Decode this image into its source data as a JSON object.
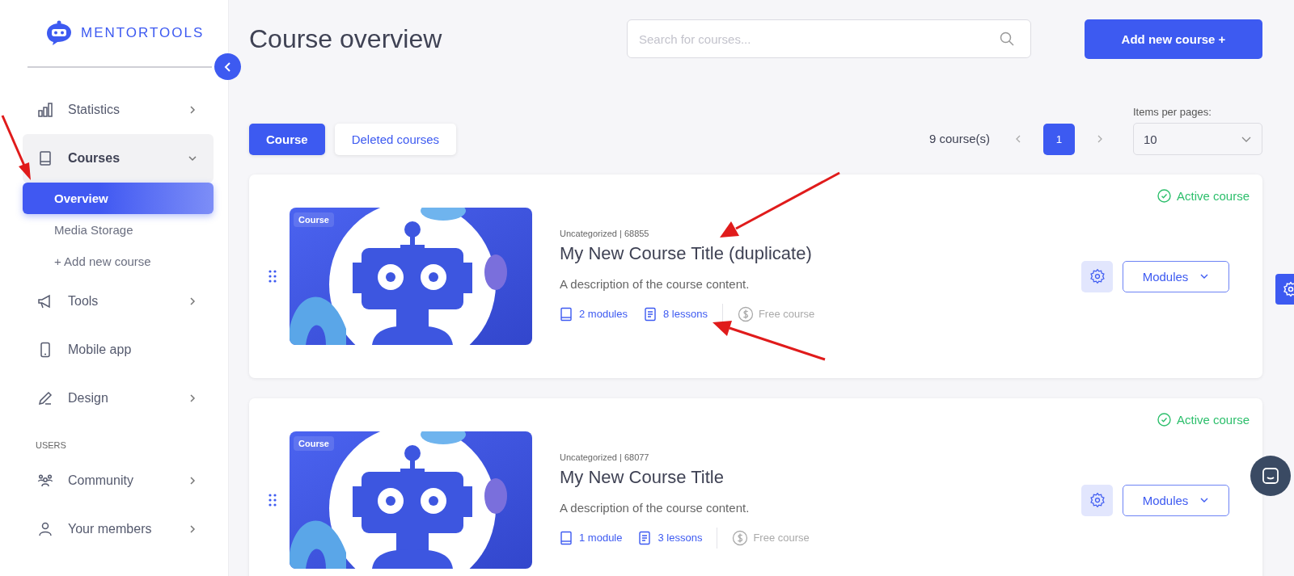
{
  "logo": {
    "text": "MENTORTOOLS"
  },
  "sidebar": {
    "items": [
      {
        "kind": "group",
        "label": "Statistics",
        "expanded": false
      },
      {
        "kind": "group",
        "label": "Courses",
        "expanded": true,
        "children": [
          {
            "label": "Overview",
            "selected": true
          },
          {
            "label": "Media Storage",
            "selected": false
          },
          {
            "label": "+ Add new course",
            "selected": false
          }
        ]
      },
      {
        "kind": "group",
        "label": "Tools",
        "expanded": false
      },
      {
        "kind": "link",
        "label": "Mobile app"
      },
      {
        "kind": "group",
        "label": "Design",
        "expanded": false
      },
      {
        "kind": "section",
        "label": "USERS"
      },
      {
        "kind": "group",
        "label": "Community",
        "expanded": false
      },
      {
        "kind": "group",
        "label": "Your members",
        "expanded": false
      }
    ]
  },
  "header": {
    "title": "Course overview",
    "search": {
      "placeholder": "Search for courses..."
    },
    "add_button": "Add new course +"
  },
  "tabs": [
    {
      "label": "Course",
      "selected": true
    },
    {
      "label": "Deleted courses",
      "selected": false
    }
  ],
  "pagination": {
    "count": "9 course(s)",
    "pages": [
      {
        "label": "1",
        "selected": true
      }
    ],
    "per_page_label": "Items per pages:",
    "per_page_value": "10"
  },
  "courses": [
    {
      "badge": "Course",
      "meta": "Uncategorized | 68855",
      "title": "My New Course Title (duplicate)",
      "description": "A description of the course content.",
      "modules": "2 modules",
      "lessons": "8 lessons",
      "price": "Free course",
      "status": "Active course",
      "active": true,
      "modules_button": "Modules"
    },
    {
      "badge": "Course",
      "meta": "Uncategorized | 68077",
      "title": "My New Course Title",
      "description": "A description of the course content.",
      "modules": "1 module",
      "lessons": "3 lessons",
      "price": "Free course",
      "status": "Active course",
      "active": true,
      "modules_button": "Modules"
    }
  ]
}
